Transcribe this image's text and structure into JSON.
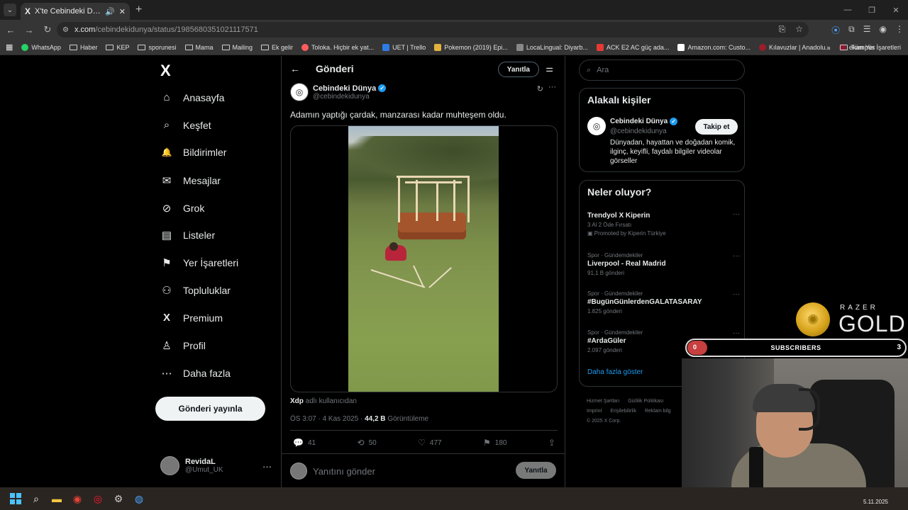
{
  "browser": {
    "tab_title": "X'te Cebindeki Dünya: \"Ada",
    "url_host": "x.com",
    "url_path": "/cebindekidunya/status/1985680351021117571",
    "bookmarks": [
      "WhatsApp",
      "Haber",
      "KEP",
      "sporunesi",
      "Mama",
      "Mailing",
      "Ek gelir",
      "Toloka. Hiçbir ek yat...",
      "UET | Trello",
      "Pokemon (2019) Epi...",
      "LocaLingual: Diyarb...",
      "ACK E2 AC güç ada...",
      "Amazon.com: Custo...",
      "Kılavuzlar | Anadolu...",
      "ekampüs"
    ],
    "bookmarks_more": "»",
    "all_bookmarks": "Tüm Yer İşaretleri"
  },
  "sidebar": {
    "logo": "X",
    "items": [
      {
        "label": "Anasayfa",
        "icon": "⌂"
      },
      {
        "label": "Keşfet",
        "icon": "⌕"
      },
      {
        "label": "Bildirimler",
        "icon": "🔔"
      },
      {
        "label": "Mesajlar",
        "icon": "✉"
      },
      {
        "label": "Grok",
        "icon": "⊘"
      },
      {
        "label": "Listeler",
        "icon": "▤"
      },
      {
        "label": "Yer İşaretleri",
        "icon": "⚑"
      },
      {
        "label": "Topluluklar",
        "icon": "⚇"
      },
      {
        "label": "Premium",
        "icon": "X"
      },
      {
        "label": "Profil",
        "icon": "♙"
      },
      {
        "label": "Daha fazla",
        "icon": "⋯"
      }
    ],
    "post_button": "Gönderi yayınla",
    "user_name": "RevidaL",
    "user_handle": "@Umut_UK",
    "more": "···"
  },
  "main": {
    "header_title": "Gönderi",
    "header_reply": "Yanıtla",
    "author_name": "Cebindeki Dünya",
    "author_handle": "@cebindekidunya",
    "text": "Adamın yaptığı çardak, manzarası kadar muhteşem oldu.",
    "source_user": "Xdp",
    "source_suffix": "adlı kullanıcıdan",
    "time": "ÖS 3:07 · 4 Kas 2025 · ",
    "views_count": "44,2 B",
    "views_label": "Görüntüleme",
    "replies": "41",
    "reposts": "50",
    "likes": "477",
    "bookmarks": "180",
    "reply_placeholder": "Yanıtını gönder",
    "reply_button": "Yanıtla"
  },
  "right": {
    "search_placeholder": "Ara",
    "related_title": "Alakalı kişiler",
    "related_name": "Cebindeki Dünya",
    "related_handle": "@cebindekidunya",
    "follow": "Takip et",
    "related_bio": "Dünyadan, hayattan ve doğadan komik, ilginç, keyifli, faydalı bilgiler videolar görseller",
    "trends_title": "Neler oluyor?",
    "trends": [
      {
        "ctx": "",
        "name": "Trendyol X Kiperin",
        "cnt": "3 Al 2 Öde Fırsatı",
        "promo": "Promoted by Kiperin Türkiye"
      },
      {
        "ctx": "Spor · Gündemdekiler",
        "name": "Liverpool - Real Madrid",
        "cnt": "91,1 B gönderi",
        "promo": ""
      },
      {
        "ctx": "Spor · Gündemdekiler",
        "name": "#BugünGünlerdenGALATASARAY",
        "cnt": "1.825 gönderi",
        "promo": ""
      },
      {
        "ctx": "Spor · Gündemdekiler",
        "name": "#ArdaGüler",
        "cnt": "2.097 gönderi",
        "promo": ""
      }
    ],
    "show_more": "Daha fazla göster",
    "footer": [
      "Hizmet Şartları",
      "Gizlilik Politikası",
      "Imprint",
      "Erişilebilirlik",
      "Reklam bilg",
      "© 2025 X Corp."
    ]
  },
  "overlay": {
    "razer_brand": "RAZER",
    "razer_gold": "GOLD",
    "subs_current": "0",
    "subs_label": "SUBSCRIBERS",
    "subs_goal": "3",
    "subs_progress": 0.0
  },
  "taskbar": {
    "clock": "5.11.2025"
  }
}
